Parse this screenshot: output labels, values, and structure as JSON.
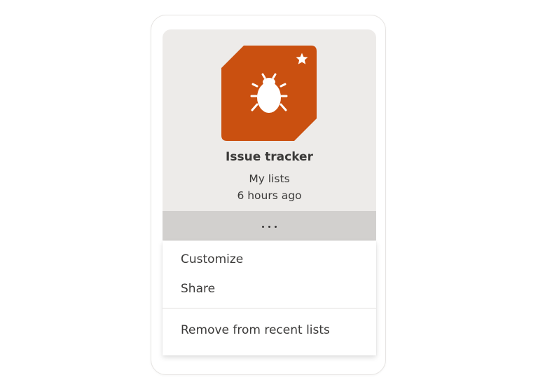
{
  "card": {
    "title": "Issue tracker",
    "location": "My lists",
    "modified": "6 hours ago",
    "icon": "bug-icon",
    "favorite_icon": "star-icon",
    "tile_color": "#ca5010",
    "more_label": "..."
  },
  "menu": {
    "items": [
      {
        "label": "Customize"
      },
      {
        "label": "Share"
      },
      {
        "label": "Remove from recent lists"
      }
    ]
  }
}
